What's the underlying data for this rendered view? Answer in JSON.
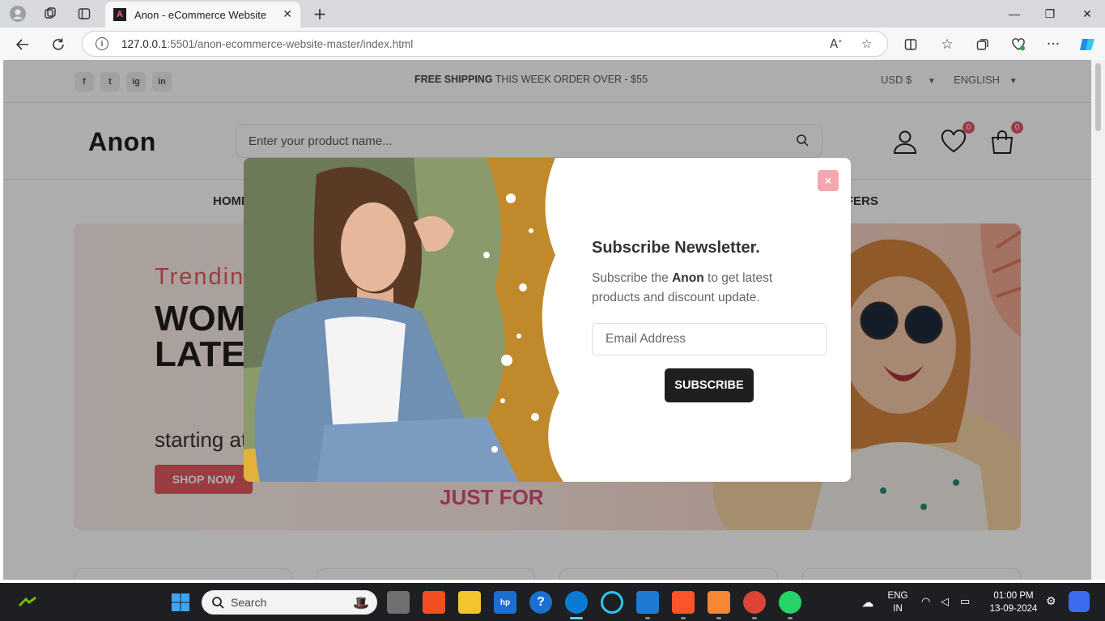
{
  "browser": {
    "tab_title": "Anon - eCommerce Website",
    "url_host": "127.0.0.1",
    "url_rest": ":5501/anon-ecommerce-website-master/index.html"
  },
  "site": {
    "topbar": {
      "social": [
        "f",
        "t",
        "ig",
        "in"
      ],
      "alert_bold": "FREE SHIPPING",
      "alert_rest": " THIS WEEK ORDER OVER - $55",
      "currency": "USD $",
      "language": "ENGLISH"
    },
    "logo": "Anon",
    "search_placeholder": "Enter your product name...",
    "wishlist_count": "0",
    "cart_count": "0",
    "menu": {
      "home": "HOME",
      "offers": "OFFERS"
    },
    "banner": {
      "subtitle": "Trending",
      "title": "WOMEN'S LATEST FASHION",
      "text": "starting at",
      "button": "SHOP NOW",
      "badge": "JUST FOR"
    }
  },
  "modal": {
    "title": "Subscribe Newsletter.",
    "text_before": "Subscribe the ",
    "text_brand": "Anon",
    "text_after": " to get latest products and discount update.",
    "email_placeholder": "Email Address",
    "button": "SUBSCRIBE",
    "close": "×"
  },
  "taskbar": {
    "search_label": "Search",
    "lang_top": "ENG",
    "lang_bottom": "IN",
    "time": "01:00 PM",
    "date": "13-09-2024"
  },
  "colors": {
    "accent": "#e25a63",
    "dark": "#1f1f1f",
    "close_bg": "#f4a7ae"
  }
}
